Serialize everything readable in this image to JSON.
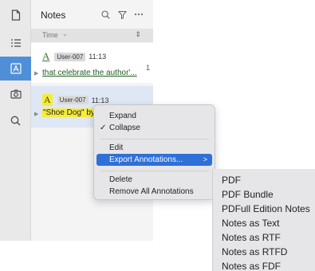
{
  "rail": {
    "items": [
      {
        "icon": "document-icon"
      },
      {
        "icon": "list-icon"
      },
      {
        "icon": "annotation-icon",
        "active": true
      },
      {
        "icon": "camera-icon"
      },
      {
        "icon": "search-icon"
      }
    ]
  },
  "panel": {
    "title": "Notes",
    "sort_label": "Time",
    "sort_chevron": "⌄",
    "sort_updown": "⇕"
  },
  "annotations": [
    {
      "marker": "A",
      "user": "User-007",
      "time": "11:13",
      "snippet": "that celebrate the author'...",
      "count": "1"
    },
    {
      "marker": "A",
      "user": "User-007",
      "time": "11:13",
      "snippet": "\"Shoe Dog\" by"
    }
  ],
  "context_menu": {
    "expand": "Expand",
    "collapse": "Collapse",
    "check": "✓",
    "edit": "Edit",
    "export": "Export Annotations...",
    "export_arrow": ">",
    "delete": "Delete",
    "remove_all": "Remove All Annotations"
  },
  "submenu": {
    "items": [
      "PDF",
      "PDF Bundle",
      "PDFull Edition Notes",
      "Notes as Text",
      "Notes as RTF",
      "Notes as RTFD",
      "Notes as FDF"
    ]
  },
  "colors": {
    "accent": "#2f6fd8",
    "rail_active": "#4f8fd8",
    "highlight_yellow": "#f5ec3a",
    "underline_green": "#3a7a2c"
  }
}
